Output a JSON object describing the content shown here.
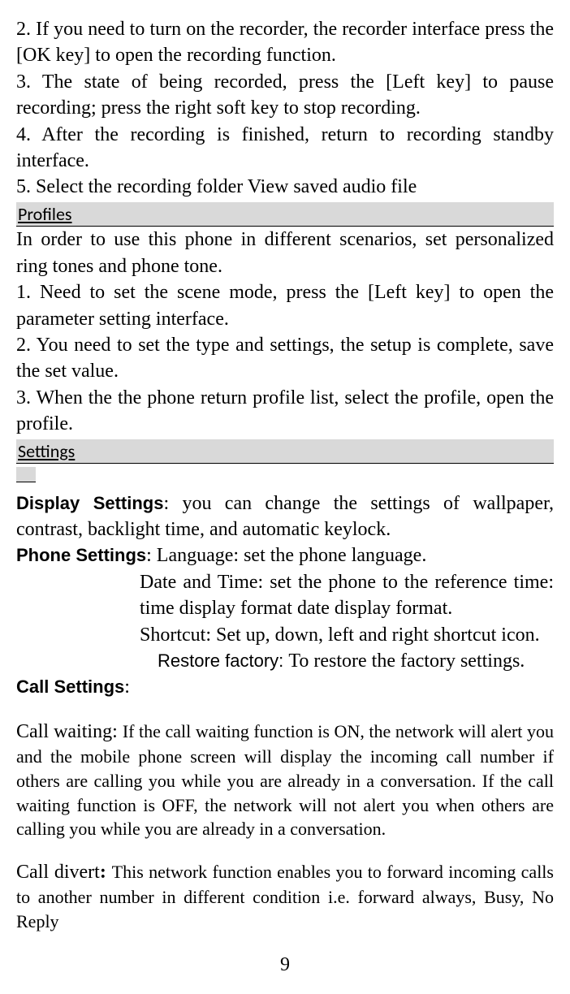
{
  "recorder": {
    "item2": "2. If you need to turn on the recorder, the recorder interface press the [OK key] to open the recording function.",
    "item3": "3. The state of being recorded, press the [Left key] to pause recording; press the right soft key to stop recording.",
    "item4": "4. After the recording is finished, return to recording standby interface.",
    "item5": "5. Select the recording folder View saved audio file"
  },
  "profiles": {
    "header": "Profiles",
    "intro": "In order to use this phone in different scenarios, set personalized ring tones and phone tone.",
    "item1": "1. Need to set the scene mode, press the [Left key] to open the parameter setting interface.",
    "item2": "2. You need to set the type and settings, the setup is complete, save the set value.",
    "item3": "3. When the the phone return profile list, select the profile, open the profile."
  },
  "settings": {
    "header": "Settings",
    "display_label": "Display Settings",
    "display_text": ": you can change the settings of wallpaper, contrast, backlight time, and automatic keylock.",
    "phone_label": "Phone Settings",
    "phone_lang": ": Language:   set the phone language.",
    "phone_datetime": "Date and Time:  set the phone to the reference time: time display format date display format.",
    "phone_shortcut": "Shortcut:   Set up, down, left and right shortcut icon.",
    "restore_label": "Restore factory: ",
    "restore_text": "To restore the factory settings.",
    "call_label": "Call Settings",
    "call_colon": ":",
    "call_waiting_label": "Call waiting:  ",
    "call_waiting_text": "If the call waiting function is ON, the network will alert you and the mobile phone screen will display the incoming call number if others are calling you while you are already in a conversation. If the call waiting function is OFF, the network will not alert you when others are calling you while you are already in a conversation.",
    "call_divert_label": "Call divert",
    "call_divert_bold": ": ",
    "call_divert_text": "This network function enables you to forward incoming calls to another number in different condition i.e. forward always, Busy, No Reply"
  },
  "page_number": "9"
}
